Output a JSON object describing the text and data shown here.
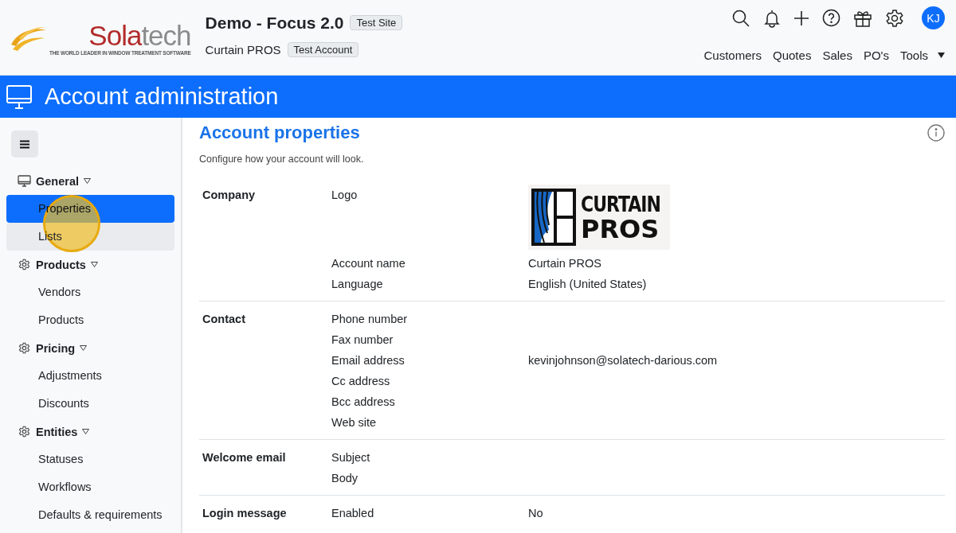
{
  "header": {
    "logo": {
      "name": "Solatech",
      "tagline": "THE WORLD LEADER IN WINDOW TREATMENT SOFTWARE"
    },
    "site_title": "Demo - Focus 2.0",
    "site_badge": "Test Site",
    "account_name": "Curtain PROS",
    "account_badge": "Test Account",
    "icons": [
      {
        "kind": "search"
      },
      {
        "kind": "bell"
      },
      {
        "kind": "plus"
      },
      {
        "kind": "help"
      },
      {
        "kind": "gift"
      },
      {
        "kind": "settings"
      }
    ],
    "avatar": "KJ",
    "nav": [
      {
        "label": "Customers",
        "kind": "link"
      },
      {
        "label": "Quotes",
        "kind": "link"
      },
      {
        "label": "Sales",
        "kind": "link"
      },
      {
        "label": "PO's",
        "kind": "link"
      },
      {
        "label": "Tools",
        "kind": "dropdown"
      }
    ]
  },
  "banner": {
    "title": "Account administration"
  },
  "sidebar": {
    "click_marker": true,
    "groups": [
      {
        "label": "General",
        "kind": "monitor",
        "expanded": true,
        "items": [
          {
            "label": "Properties",
            "selected": true,
            "hovered": false
          },
          {
            "label": "Lists",
            "selected": false,
            "hovered": true
          }
        ]
      },
      {
        "label": "Products",
        "kind": "gear",
        "expanded": true,
        "items": [
          {
            "label": "Vendors",
            "selected": false,
            "hovered": false
          },
          {
            "label": "Products",
            "selected": false,
            "hovered": false
          }
        ]
      },
      {
        "label": "Pricing",
        "kind": "gear",
        "expanded": true,
        "items": [
          {
            "label": "Adjustments",
            "selected": false,
            "hovered": false
          },
          {
            "label": "Discounts",
            "selected": false,
            "hovered": false
          }
        ]
      },
      {
        "label": "Entities",
        "kind": "gear",
        "expanded": true,
        "items": [
          {
            "label": "Statuses",
            "selected": false,
            "hovered": false
          },
          {
            "label": "Workflows",
            "selected": false,
            "hovered": false
          },
          {
            "label": "Defaults & requirements",
            "selected": false,
            "hovered": false
          }
        ]
      }
    ]
  },
  "content": {
    "title": "Account properties",
    "subtitle": "Configure how your account will look.",
    "sections": [
      {
        "label": "Company",
        "fields": [
          {
            "label": "Logo",
            "kind": "logo",
            "logo_lines": [
              "CURTAIN",
              "PROS"
            ]
          },
          {
            "label": "Account name",
            "kind": "text",
            "value": "Curtain PROS"
          },
          {
            "label": "Language",
            "kind": "text",
            "value": "English (United States)"
          }
        ]
      },
      {
        "label": "Contact",
        "fields": [
          {
            "label": "Phone number",
            "kind": "text"
          },
          {
            "label": "Fax number",
            "kind": "text"
          },
          {
            "label": "Email address",
            "kind": "text",
            "value": "kevinjohnson@solatech-darious.com"
          },
          {
            "label": "Cc address",
            "kind": "text"
          },
          {
            "label": "Bcc address",
            "kind": "text"
          },
          {
            "label": "Web site",
            "kind": "text"
          }
        ]
      },
      {
        "label": "Welcome email",
        "fields": [
          {
            "label": "Subject",
            "kind": "text"
          },
          {
            "label": "Body",
            "kind": "text"
          }
        ]
      },
      {
        "label": "Login message",
        "fields": [
          {
            "label": "Enabled",
            "kind": "text",
            "value": "No"
          }
        ]
      }
    ]
  }
}
